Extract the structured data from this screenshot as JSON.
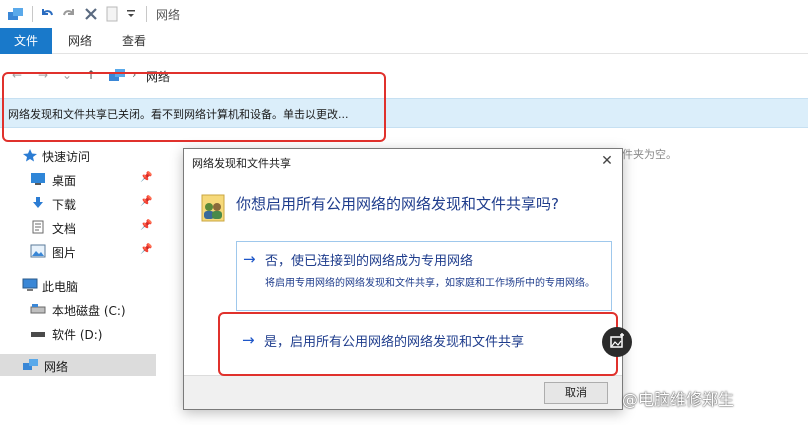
{
  "window": {
    "title": "网络"
  },
  "ribbon": {
    "tabs": [
      {
        "label": "文件",
        "active": true
      },
      {
        "label": "网络",
        "active": false
      },
      {
        "label": "查看",
        "active": false
      }
    ]
  },
  "address": {
    "location": "网络"
  },
  "infobar": {
    "text": "网络发现和文件共享已关闭。看不到网络计算机和设备。单击以更改..."
  },
  "sidebar": {
    "items": [
      {
        "label": "快速访问",
        "icon": "star-icon"
      },
      {
        "label": "桌面",
        "icon": "desktop-icon"
      },
      {
        "label": "下载",
        "icon": "download-icon"
      },
      {
        "label": "文档",
        "icon": "document-icon"
      },
      {
        "label": "图片",
        "icon": "picture-icon"
      },
      {
        "label": "此电脑",
        "icon": "computer-icon"
      },
      {
        "label": "本地磁盘 (C:)",
        "icon": "drive-icon"
      },
      {
        "label": "软件 (D:)",
        "icon": "drive-icon"
      },
      {
        "label": "网络",
        "icon": "network-icon"
      }
    ]
  },
  "content": {
    "empty_text": "件夹为空。"
  },
  "dialog": {
    "title": "网络发现和文件共享",
    "close": "✕",
    "question": "你想启用所有公用网络的网络发现和文件共享吗?",
    "option_no": {
      "title": "否，使已连接到的网络成为专用网络",
      "description": "将启用专用网络的网络发现和文件共享，如家庭和工作场所中的专用网络。"
    },
    "option_yes": {
      "title": "是，启用所有公用网络的网络发现和文件共享"
    },
    "cancel_label": "取消"
  },
  "watermark": "@电脑维修郑生",
  "colors": {
    "accent": "#1979ca",
    "infobar_bg": "#dbeefa",
    "dialog_text": "#1e3c8c",
    "highlight": "#e0312c"
  }
}
